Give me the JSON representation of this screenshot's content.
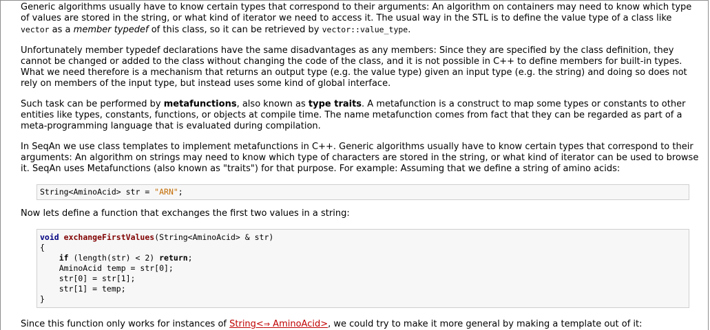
{
  "para1": {
    "t1": "Generic algorithms usually have to know certain types that correspond to their arguments: An algorithm on containers may need to know which type of values are stored in the string, or what kind of iterator we need to access it. The usual way in the STL is to define the value type of a class like ",
    "c1": "vector",
    "t2": " as a ",
    "em1": "member typedef",
    "t3": " of this class, so it can be retrieved by ",
    "c2": "vector::value_type",
    "t4": "."
  },
  "para2": {
    "text": "Unfortunately member typedef declarations have the same disadvantages as any members: Since they are specified by the class definition, they cannot be changed or added to the class without changing the code of the class, and it is not possible in C++ to define members for built-in types. What we need therefore is a mechanism that returns an output type (e.g. the value type) given an input type (e.g. the string) and doing so does not rely on members of the input type, but instead uses some kind of global interface."
  },
  "para3": {
    "t1": "Such task can be performed by ",
    "b1": "metafunctions",
    "t2": ", also known as ",
    "b2": "type traits",
    "t3": ". A metafunction is a construct to map some types or constants to other entities like types, constants, functions, or objects at compile time. The name metafunction comes from fact that they can be regarded as part of a meta-programming language that is evaluated during compilation."
  },
  "para4": {
    "text": "In SeqAn we use class templates to implement metafunctions in C++. Generic algorithms usually have to know certain types that correspond to their arguments: An algorithm on strings may need to know which type of characters are stored in the string, or what kind of iterator can be used to browse it. SeqAn uses Metafunctions (also known as \"traits\") for that purpose. For example: Assuming that we define a string of amino acids:"
  },
  "code1": {
    "part1": "String<AminoAcid> str = ",
    "str": "\"ARN\"",
    "part2": ";"
  },
  "para5": {
    "text": "Now lets define a function that exchanges the first two values in a string:"
  },
  "code2": {
    "kw_void": "void",
    "fn_name": "exchangeFirstValues",
    "sig": "(String<AminoAcid> & str)",
    "open": "{",
    "l1a": "    ",
    "kw_if": "if",
    "l1b": " (length(str) < 2) ",
    "kw_return": "return",
    "l1c": ";",
    "l2": "    AminoAcid temp = str[0];",
    "l3": "    str[0] = str[1];",
    "l4": "    str[1] = temp;",
    "close": "}"
  },
  "para6": {
    "t1": "Since this function only works for instances of ",
    "link1": "String<",
    "arrow": "⇒",
    "link2": " AminoAcid>",
    "t2": ", we could try to make it more general by making a template out of it:"
  }
}
